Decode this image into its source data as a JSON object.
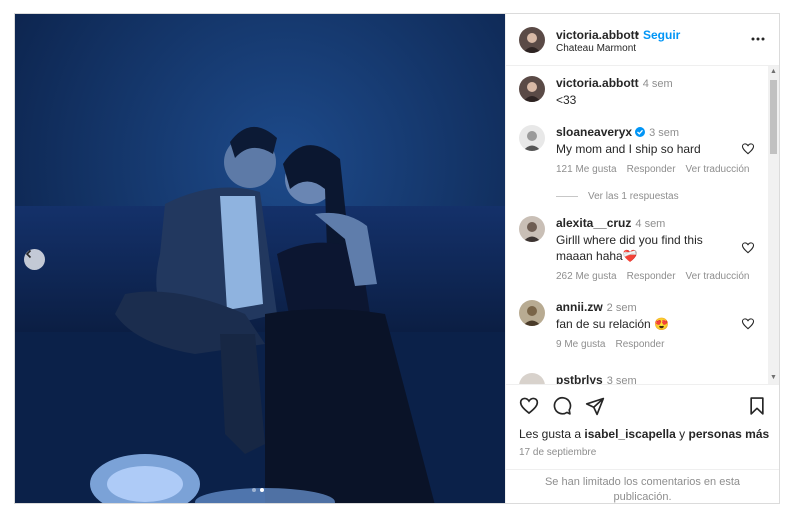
{
  "post": {
    "username": "victoria.abbott",
    "separator": "•",
    "follow_label": "Seguir",
    "location": "Chateau Marmont",
    "caption": {
      "username": "victoria.abbott",
      "time": "4 sem",
      "text": "<33"
    }
  },
  "carousel": {
    "slide_count": 2,
    "active_index": 1
  },
  "comments": [
    {
      "username": "sloaneaveryx",
      "verified": true,
      "time": "3 sem",
      "text": "My mom and I ship so hard",
      "likes": "121 Me gusta",
      "reply_label": "Responder",
      "translate_label": "Ver traducción",
      "replies_label": "Ver las 1 respuestas"
    },
    {
      "username": "alexita__cruz",
      "time": "4 sem",
      "text": "Girlll where did you find this maaan haha",
      "emoji": "❤️‍🩹",
      "likes": "262 Me gusta",
      "reply_label": "Responder",
      "translate_label": "Ver traducción"
    },
    {
      "username": "annii.zw",
      "time": "2 sem",
      "text": "fan de su relación",
      "emoji": "😍",
      "likes": "9 Me gusta",
      "reply_label": "Responder"
    },
    {
      "username": "pstbrlys",
      "time": "3 sem"
    }
  ],
  "likes_line": {
    "prefix": "Les gusta a",
    "user": "isabel_iscapella",
    "middle": "y",
    "suffix": "personas más"
  },
  "date": "17 de septiembre",
  "limited_text": "Se han limitado los comentarios en esta publicación.",
  "icons": {
    "more": "more-horizontal-icon",
    "like": "heart-icon",
    "comment": "comment-icon",
    "share": "share-icon",
    "save": "bookmark-icon",
    "prev": "chevron-left-icon"
  },
  "colors": {
    "accent": "#0095f6",
    "muted": "#8e8e8e",
    "text": "#262626",
    "photo_bg": "#102a54"
  }
}
